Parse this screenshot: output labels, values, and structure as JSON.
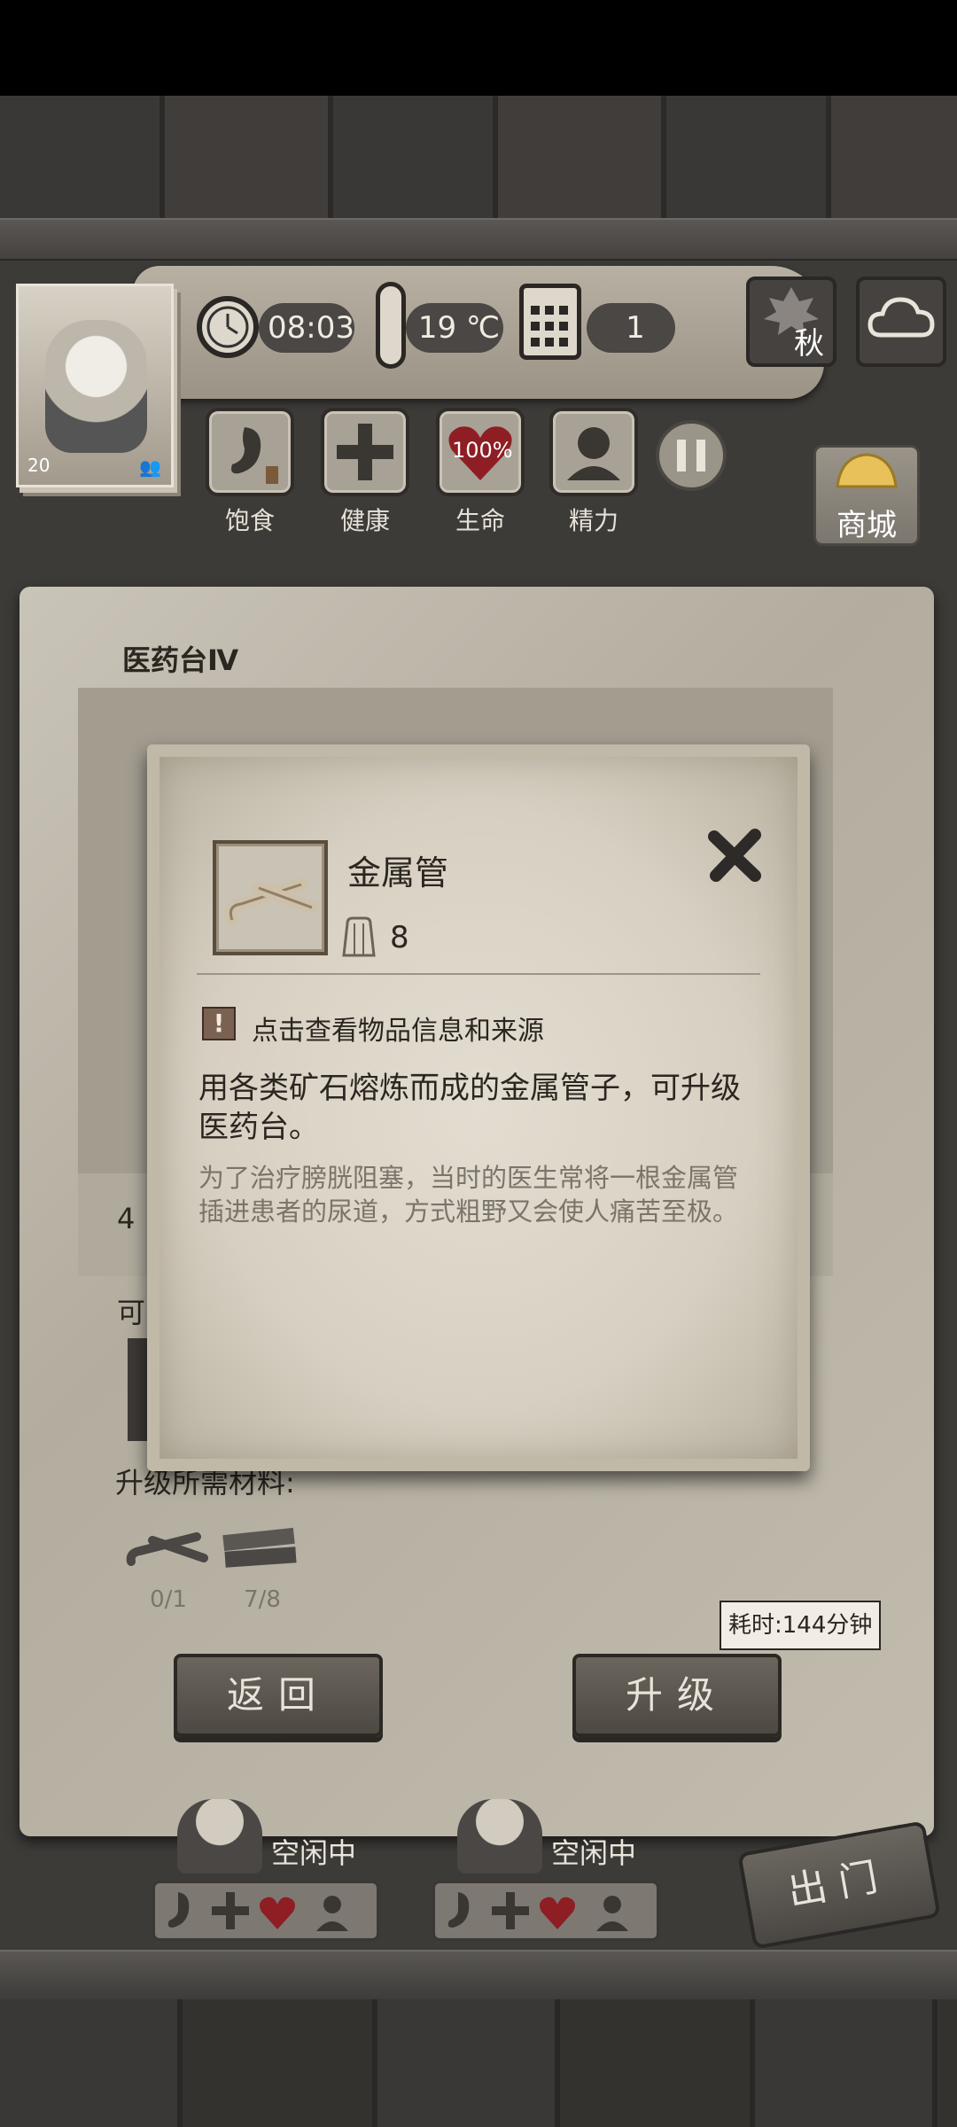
{
  "hud": {
    "player_level": "20",
    "time": "08:03",
    "temperature": "19 ℃",
    "day": "1",
    "season": "秋",
    "stats": [
      {
        "label": "饱食",
        "value": ""
      },
      {
        "label": "健康",
        "value": ""
      },
      {
        "label": "生命",
        "value": "100%"
      },
      {
        "label": "精力",
        "value": ""
      }
    ],
    "shop_label": "商城"
  },
  "panel": {
    "title": "医药台Ⅳ",
    "partial_text_1": "4",
    "partial_text_2": "可",
    "materials_label": "升级所需材料:",
    "materials": [
      {
        "icon": "metal-pipe-icon",
        "count": "0/1"
      },
      {
        "icon": "wood-planks-icon",
        "count": "7/8"
      }
    ],
    "time_cost": "耗时:144分钟",
    "back_label": "返回",
    "upgrade_label": "升级"
  },
  "modal": {
    "item_name": "金属管",
    "item_count": "8",
    "info_hint": "点击查看物品信息和来源",
    "description": "用各类矿石熔炼而成的金属管子，可升级医药台。",
    "lore": "为了治疗膀胱阻塞，当时的医生常将一根金属管插进患者的尿道，方式粗野又会使人痛苦至极。"
  },
  "survivors": [
    {
      "status": "空闲中"
    },
    {
      "status": "空闲中"
    }
  ],
  "exit_label": "出门"
}
